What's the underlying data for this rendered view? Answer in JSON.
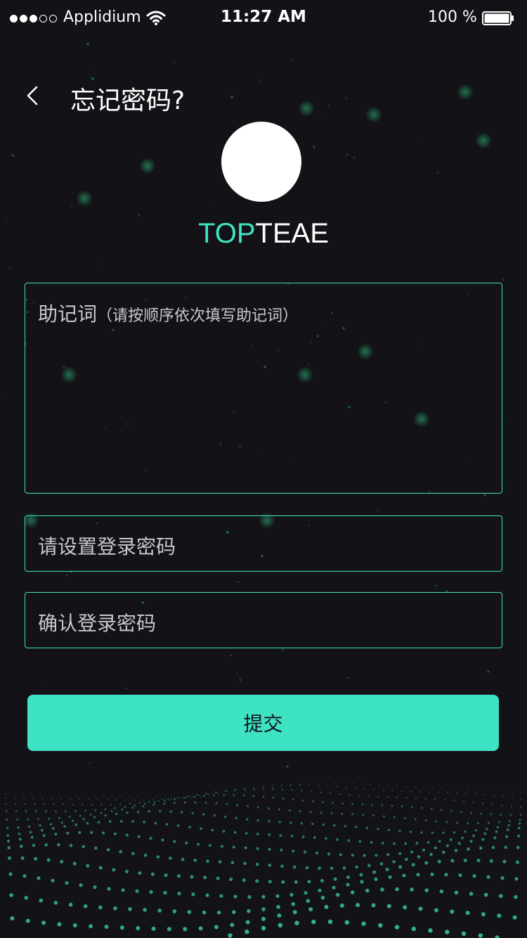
{
  "status_bar": {
    "carrier": "Applidium",
    "time": "11:27 AM",
    "battery_percent": "100 %",
    "signal_bars_filled": 3,
    "signal_bars_total": 5
  },
  "nav": {
    "title": "忘记密码?",
    "back_icon": "chevron-left-icon"
  },
  "brand": {
    "accent_part": "TOP",
    "rest_part": "TEAE"
  },
  "form": {
    "mnemonic_placeholder_main": "助记词",
    "mnemonic_placeholder_hint": "（请按顺序依次填写助记词）",
    "password_placeholder": "请设置登录密码",
    "confirm_placeholder": "确认登录密码",
    "submit_label": "提交"
  },
  "colors": {
    "background": "#131217",
    "accent": "#3ee3c3",
    "text": "#ffffff",
    "placeholder": "#c9c9cc"
  }
}
